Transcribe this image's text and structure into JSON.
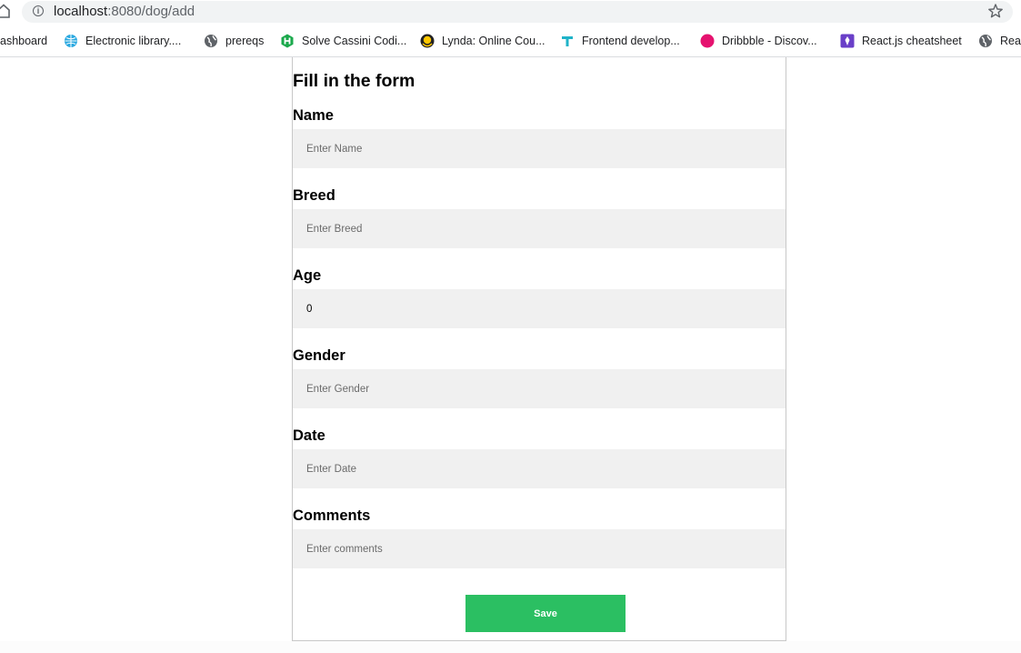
{
  "browser": {
    "url_host": "localhost",
    "url_path": ":8080/dog/add",
    "bookmarks": [
      {
        "label": "ashboard",
        "icon": "none"
      },
      {
        "label": "Electronic library....",
        "icon": "globe-blue-icon"
      },
      {
        "label": "prereqs",
        "icon": "globe-icon"
      },
      {
        "label": "Solve Cassini Codi...",
        "icon": "hackerrank-icon"
      },
      {
        "label": "Lynda: Online Cou...",
        "icon": "lynda-icon"
      },
      {
        "label": "Frontend develop...",
        "icon": "frontend-icon"
      },
      {
        "label": "Dribbble - Discov...",
        "icon": "dribbble-icon"
      },
      {
        "label": "React.js cheatsheet",
        "icon": "react-cheatsheet-icon"
      },
      {
        "label": "Reac",
        "icon": "globe-icon"
      }
    ]
  },
  "form": {
    "title": "Fill in the form",
    "fields": [
      {
        "label": "Name",
        "placeholder": "Enter Name",
        "value": ""
      },
      {
        "label": "Breed",
        "placeholder": "Enter Breed",
        "value": ""
      },
      {
        "label": "Age",
        "placeholder": "",
        "value": "0"
      },
      {
        "label": "Gender",
        "placeholder": "Enter Gender",
        "value": ""
      },
      {
        "label": "Date",
        "placeholder": "Enter Date",
        "value": ""
      },
      {
        "label": "Comments",
        "placeholder": "Enter comments",
        "value": ""
      }
    ],
    "save_label": "Save"
  },
  "colors": {
    "save_button": "#2bbf62",
    "input_background": "#f0f0f0"
  }
}
